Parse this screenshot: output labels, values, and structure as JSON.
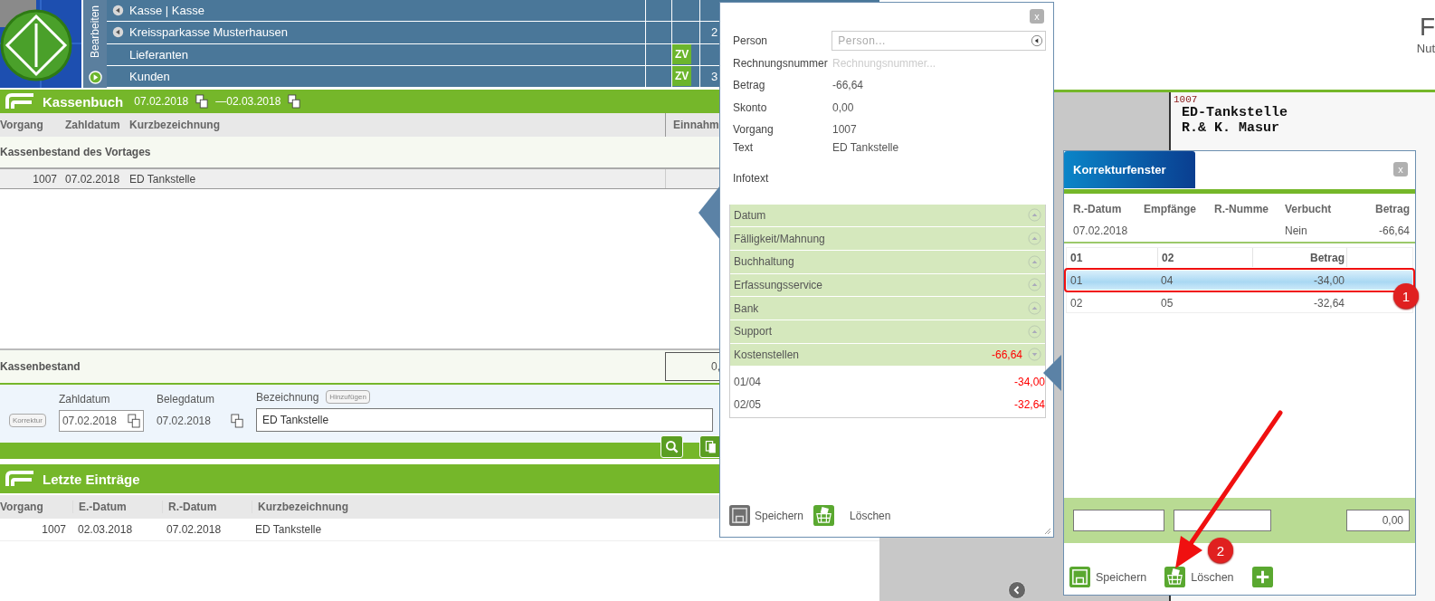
{
  "nav": {
    "side_label": "Bearbeiten",
    "rows": [
      {
        "label": "Kasse | Kasse",
        "back_arrow": true
      },
      {
        "label": "Kreissparkasse Musterhausen",
        "back_arrow": true,
        "column_4": "2"
      },
      {
        "label": "Lieferanten",
        "back_arrow": false,
        "zv": "ZV"
      },
      {
        "label": "Kunden",
        "back_arrow": false,
        "zv": "ZV",
        "column_4": "3"
      }
    ]
  },
  "cashbook": {
    "title": "Kassenbuch",
    "from": "07.02.2018",
    "to": "—02.03.2018",
    "columns": [
      "Vorgang",
      "Zahldatum",
      "Kurzbezeichnung",
      "Einnahm"
    ],
    "opening_row": "Kassenbestand des Vortages",
    "rows": [
      {
        "vorgang": "1007",
        "date": "07.02.2018",
        "text": "ED Tankstelle"
      }
    ],
    "balance": {
      "label": "Kassenbestand",
      "value": "0,"
    }
  },
  "entry_form": {
    "correction_button": "Korrektur",
    "zahldatum": {
      "label": "Zahldatum",
      "value": "07.02.2018"
    },
    "belegdatum": {
      "label": "Belegdatum",
      "value": "07.02.2018"
    },
    "bezeichnung": {
      "label": "Bezeichnung",
      "add_button": "Hinzufügen",
      "value": "ED Tankstelle"
    }
  },
  "recent": {
    "title": "Letzte Einträge",
    "columns": [
      "Vorgang",
      "E.-Datum",
      "R.-Datum",
      "Kurzbezeichnung"
    ],
    "rows": [
      [
        "1007",
        "02.03.2018",
        "07.02.2018",
        "ED Tankstelle"
      ]
    ]
  },
  "viewer": {
    "heading": "F",
    "subheading": "Nut",
    "scan": {
      "number": "1007",
      "lines": [
        "ED-Tankstelle",
        "R.& K. Masur"
      ]
    }
  },
  "detail_window": {
    "close": "x",
    "fields": [
      {
        "label": "Person",
        "kind": "select",
        "placeholder": "Person..."
      },
      {
        "label": "Rechnungsnummer",
        "kind": "input",
        "placeholder": "Rechnungsnummer..."
      },
      {
        "label": "Betrag",
        "kind": "text",
        "value": "-66,64"
      },
      {
        "label": "Skonto",
        "kind": "text",
        "value": "0,00"
      },
      {
        "label": "Vorgang",
        "kind": "text",
        "value": "1007"
      },
      {
        "label": "Text",
        "kind": "text",
        "value": "ED Tankstelle"
      },
      {
        "label": "Infotext",
        "kind": "text"
      }
    ],
    "sections": [
      {
        "label": "Datum",
        "expanded": false
      },
      {
        "label": "Fälligkeit/Mahnung",
        "expanded": false
      },
      {
        "label": "Buchhaltung",
        "expanded": false
      },
      {
        "label": "Erfassungsservice",
        "expanded": false
      },
      {
        "label": "Bank",
        "expanded": false
      },
      {
        "label": "Support",
        "expanded": false
      },
      {
        "label": "Kostenstellen",
        "expanded": true,
        "total": "-66,64"
      }
    ],
    "cost_lines": [
      {
        "code": "01/04",
        "amount": "-34,00"
      },
      {
        "code": "02/05",
        "amount": "-32,64"
      }
    ],
    "buttons": [
      {
        "label": "Speichern",
        "kind": "save"
      },
      {
        "label": "Löschen",
        "kind": "delete"
      }
    ]
  },
  "correction_window": {
    "title": "Korrekturfenster",
    "close": "x",
    "columns": [
      "R.-Datum",
      "Empfänge",
      "R.-Numme",
      "Verbucht",
      "Betrag"
    ],
    "row": {
      "r_datum": "07.02.2018",
      "verbucht": "Nein",
      "betrag": "-66,64"
    },
    "split_columns": [
      "01",
      "02",
      "Betrag"
    ],
    "split_rows": [
      {
        "c1": "01",
        "c2": "04",
        "amount": "-34,00",
        "selected": true
      },
      {
        "c1": "02",
        "c2": "05",
        "amount": "-32,64",
        "selected": false
      }
    ],
    "total": "0,00",
    "buttons": [
      {
        "label": "Speichern",
        "kind": "save"
      },
      {
        "label": "Löschen",
        "kind": "delete"
      },
      {
        "kind": "add"
      }
    ]
  },
  "annotations": [
    {
      "label": "1"
    },
    {
      "label": "2"
    }
  ]
}
